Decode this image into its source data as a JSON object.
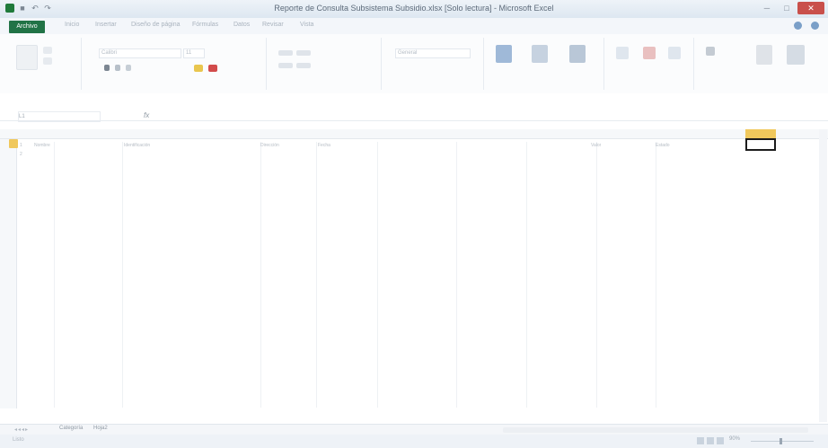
{
  "window": {
    "title": "Reporte de Consulta Subsistema Subsidio.xlsx [Solo lectura] - Microsoft Excel"
  },
  "ribbon": {
    "file_tab": "Archivo",
    "tabs": [
      "Inicio",
      "Insertar",
      "Diseño de página",
      "Fórmulas",
      "Datos",
      "Revisar",
      "Vista"
    ],
    "font_name": "Calibri",
    "font_size": "11",
    "number_format": "General"
  },
  "formula_bar": {
    "name_box": "L1",
    "fx": "fx"
  },
  "sheet": {
    "rows": [
      [
        "1",
        "Nombre",
        "Identificación",
        "Dirección",
        "Fecha",
        "Valor",
        "Estado"
      ],
      [
        "2",
        "",
        "",
        "",
        "",
        "",
        ""
      ]
    ]
  },
  "sheet_tabs": {
    "tabs": [
      "Categoría",
      "Hoja2"
    ]
  },
  "status": {
    "text": "Listo",
    "zoom": "90%"
  },
  "colors": {
    "accent": "#217346",
    "selection": "#f0c85c"
  }
}
